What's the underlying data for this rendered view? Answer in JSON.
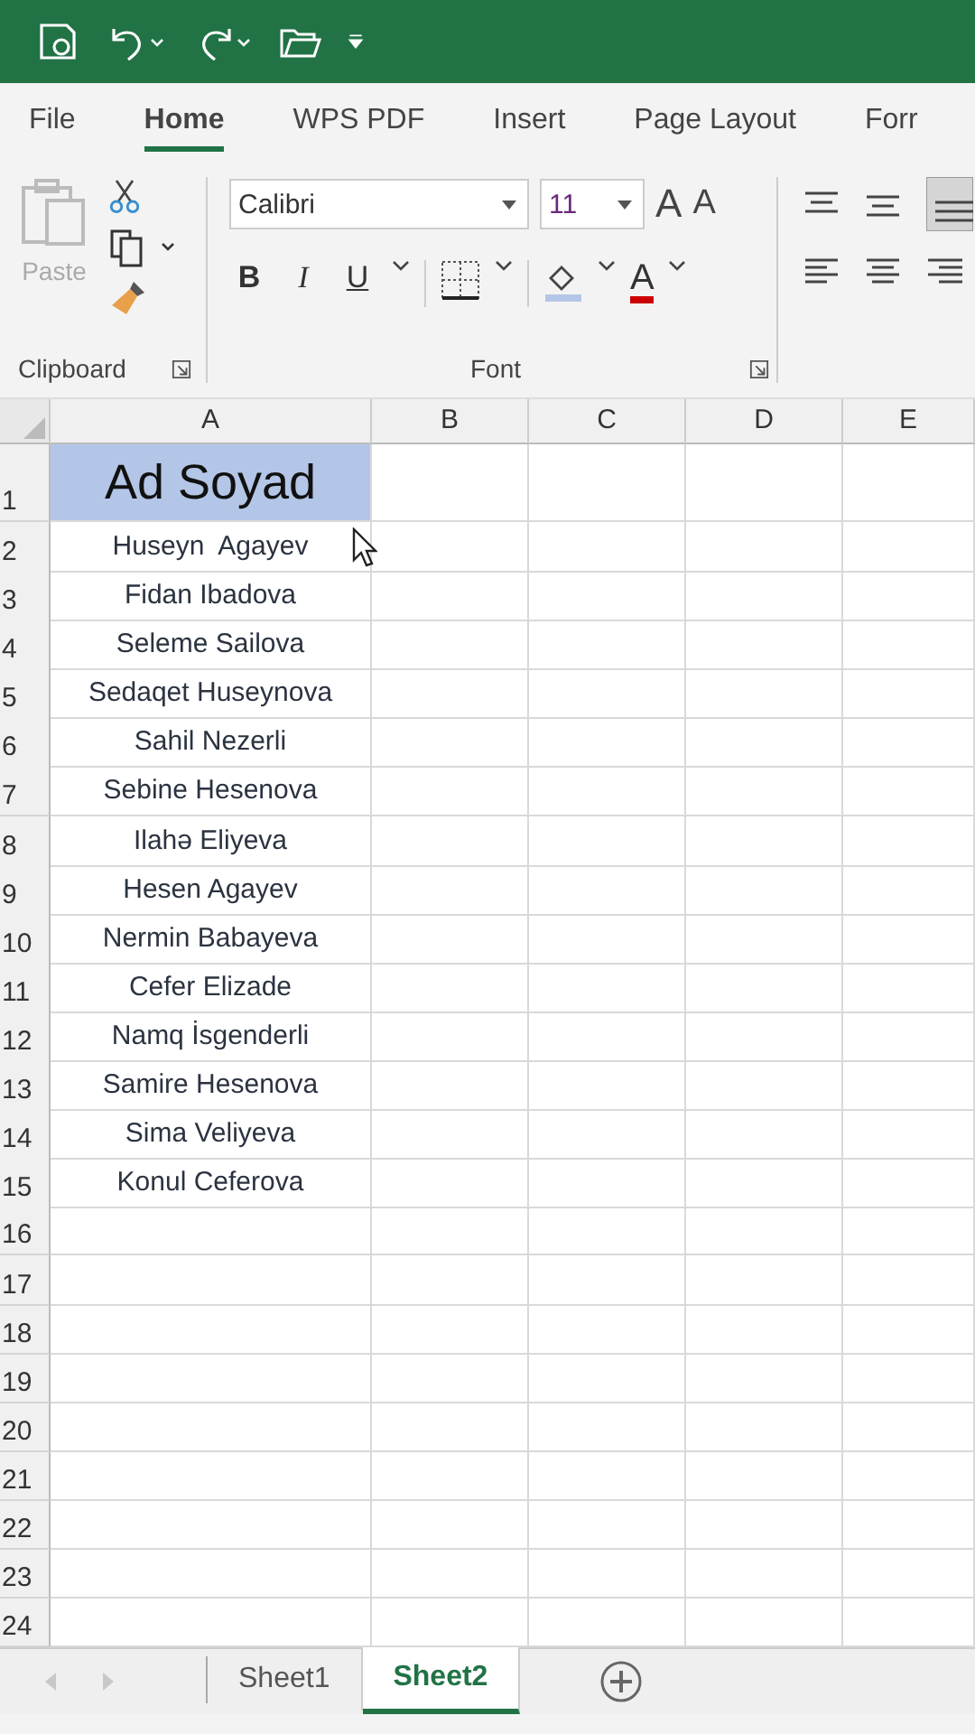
{
  "tabs": [
    {
      "label": "File",
      "selected": false
    },
    {
      "label": "Home",
      "selected": true
    },
    {
      "label": "WPS PDF",
      "selected": false
    },
    {
      "label": "Insert",
      "selected": false
    },
    {
      "label": "Page Layout",
      "selected": false
    },
    {
      "label": "Forr",
      "selected": false
    }
  ],
  "ribbon": {
    "clipboard": {
      "paste_label": "Paste",
      "group_label": "Clipboard"
    },
    "font": {
      "font_name": "Calibri",
      "font_size": "11",
      "grow": "A",
      "shrink": "A",
      "bold": "B",
      "italic": "I",
      "underline": "U",
      "color_letter": "A",
      "group_label": "Font"
    }
  },
  "columns": [
    "A",
    "B",
    "C",
    "D",
    "E"
  ],
  "header_row": {
    "number": "1",
    "text": "Ad Soyad"
  },
  "rows": [
    {
      "number": "2",
      "name": "Huseyn  Agayev"
    },
    {
      "number": "3",
      "name": "Fidan Ibadova"
    },
    {
      "number": "4",
      "name": "Seleme Sailova"
    },
    {
      "number": "5",
      "name": "Sedaqet Huseynova"
    },
    {
      "number": "6",
      "name": "Sahil Nezerli"
    },
    {
      "number": "7",
      "name": "Sebine Hesenova"
    },
    {
      "number": "8",
      "name": "Ilahə Eliyeva"
    },
    {
      "number": "9",
      "name": "Hesen Agayev"
    },
    {
      "number": "10",
      "name": "Nermin Babayeva"
    },
    {
      "number": "11",
      "name": "Cefer Elizade"
    },
    {
      "number": "12",
      "name": "Namq İsgenderli"
    },
    {
      "number": "13",
      "name": "Samire Hesenova"
    },
    {
      "number": "14",
      "name": "Sima Veliyeva"
    },
    {
      "number": "15",
      "name": "Konul Ceferova"
    }
  ],
  "empty_rows": [
    "16",
    "17",
    "18",
    "19",
    "20",
    "21",
    "22",
    "23",
    "24"
  ],
  "sheets": [
    {
      "label": "Sheet1",
      "selected": false
    },
    {
      "label": "Sheet2",
      "selected": true
    }
  ]
}
